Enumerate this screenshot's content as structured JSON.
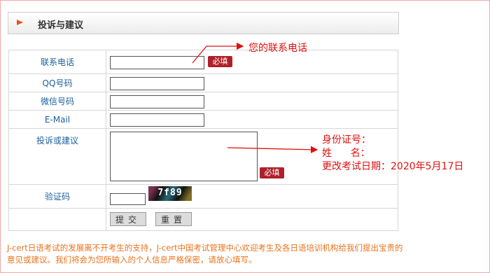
{
  "header": {
    "title": "投诉与建议"
  },
  "form": {
    "rows": [
      {
        "label": "联系电话",
        "value": "",
        "required": "必填"
      },
      {
        "label": "QQ号码",
        "value": ""
      },
      {
        "label": "微信号码",
        "value": ""
      },
      {
        "label": "E-Mail",
        "value": ""
      },
      {
        "label": "投诉或建议",
        "value": "",
        "required": "必填"
      },
      {
        "label": "验证码",
        "value": ""
      }
    ],
    "captcha_text": "7f89",
    "submit_label": "提交",
    "reset_label": "重置"
  },
  "annotations": {
    "phone_note": "您的联系电话",
    "id_line": "身份证号：",
    "name_line": "姓      名：",
    "date_line": "更改考试日期：2020年5月17日"
  },
  "footer": {
    "text": "J-cert日语考试的发展离不开考生的支持，J-cert中国考试管理中心欢迎考生及各日语培训机构给我们提出宝贵的意见或建议。我们将会为您所输入的个人信息严格保密，请放心填写。"
  },
  "colors": {
    "accent": "#e8541e",
    "required_bg": "#b0202a",
    "annotation": "#e01010",
    "label_blue": "#1a5f9c",
    "footer_orange": "#e8731e"
  }
}
